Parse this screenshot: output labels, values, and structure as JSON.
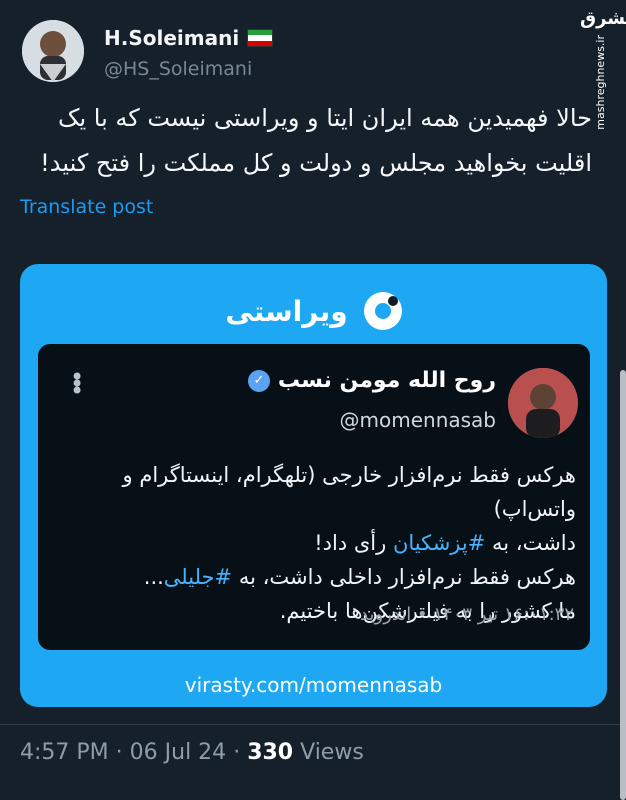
{
  "tweet": {
    "author_name": "H.Soleimani",
    "handle": "@HS_Soleimani",
    "text_line1": "حالا فهمیدین همه ایران ایتا و ویراستی نیست که با یک",
    "text_line2": "اقلیت بخواهید مجلس و دولت و کل مملکت را فتح کنید!",
    "translate": "Translate post",
    "flag_colors": [
      "#239f40",
      "#ffffff",
      "#da0000"
    ]
  },
  "watermark": {
    "logo": "مشرق",
    "url": "mashreghnews.ir"
  },
  "card": {
    "brand": "ویراستی",
    "inner": {
      "name": "روح الله مومن نسب",
      "handle": "@momennasab",
      "line1": "هرکس فقط نرم‌افزار خارجی (تلهگرام، اینستاگرام و واتس‌اپ)",
      "line2_before": "داشت، به",
      "line2_hashtag": "#پزشکیان",
      "line2_after": "رأی داد!",
      "line3_before": "هرکس فقط نرم‌افزار داخلی داشت، به",
      "line3_hashtag": "#جلیلی",
      "line3_after": "...",
      "line4": "ما کشور را به فیلترشکن‌ها باختیم.",
      "date": "۱۶:۰۱:۳۲ تیر ۱۴۰۳ • اندروید"
    },
    "link": "virasty.com/momennasab"
  },
  "meta": {
    "time": "4:57 PM",
    "date": "06 Jul 24",
    "views": "330",
    "views_label": "Views",
    "separator": "·"
  }
}
